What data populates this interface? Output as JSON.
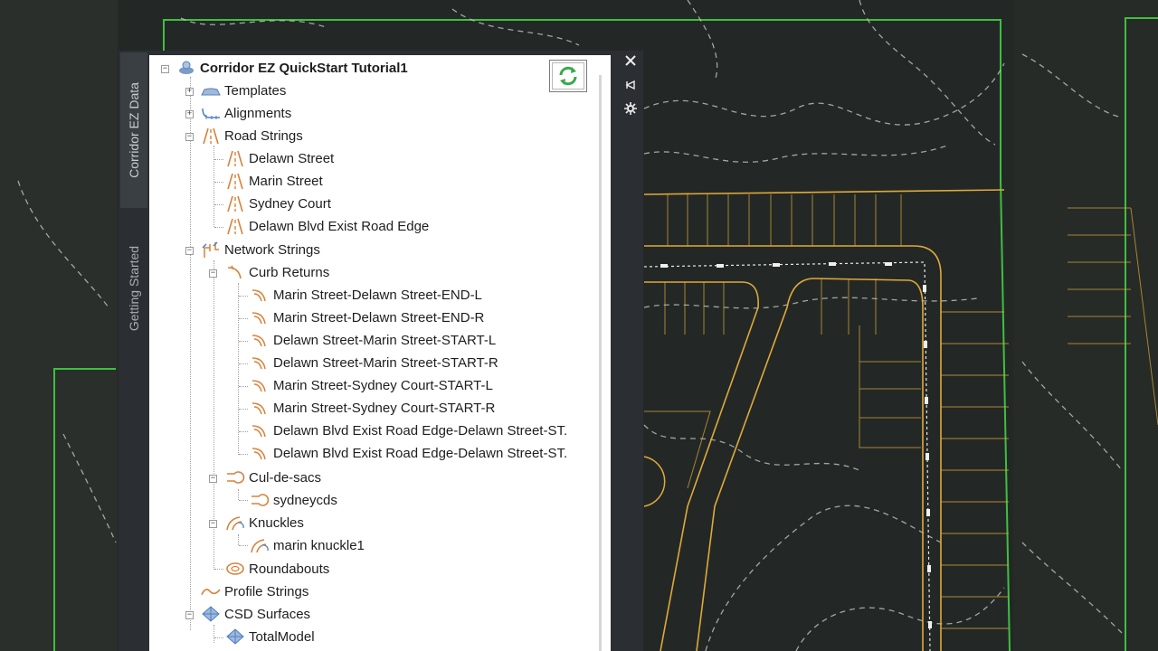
{
  "palette": {
    "side_tabs": [
      "Corridor EZ Data",
      "Getting Started"
    ],
    "controls": {
      "close": "✕",
      "auto_hide": "⧗",
      "settings": "✱"
    }
  },
  "tree": {
    "root": "Corridor EZ QuickStart Tutorial1",
    "templates": "Templates",
    "alignments": "Alignments",
    "road_strings": {
      "label": "Road Strings",
      "items": [
        "Delawn Street",
        "Marin Street",
        "Sydney Court",
        "Delawn Blvd Exist Road Edge"
      ]
    },
    "network_strings": {
      "label": "Network Strings",
      "curb_returns": {
        "label": "Curb Returns",
        "items": [
          "Marin Street-Delawn Street-END-L",
          "Marin Street-Delawn Street-END-R",
          "Delawn Street-Marin Street-START-L",
          "Delawn Street-Marin Street-START-R",
          "Marin Street-Sydney Court-START-L",
          "Marin Street-Sydney Court-START-R",
          "Delawn Blvd Exist Road Edge-Delawn Street-ST.",
          "Delawn Blvd Exist Road Edge-Delawn Street-ST."
        ]
      },
      "cul_de_sacs": {
        "label": "Cul-de-sacs",
        "items": [
          "sydneycds"
        ]
      },
      "knuckles": {
        "label": "Knuckles",
        "items": [
          "marin knuckle1"
        ]
      },
      "roundabouts": "Roundabouts"
    },
    "profile_strings": "Profile Strings",
    "csd_surfaces": {
      "label": "CSD Surfaces",
      "items": [
        "TotalModel"
      ]
    }
  },
  "colors": {
    "parcel_line": "#e0a93a",
    "boundary": "#3fbf3f",
    "contour": "#b8bcb8",
    "road_icon": "#d8823a"
  }
}
